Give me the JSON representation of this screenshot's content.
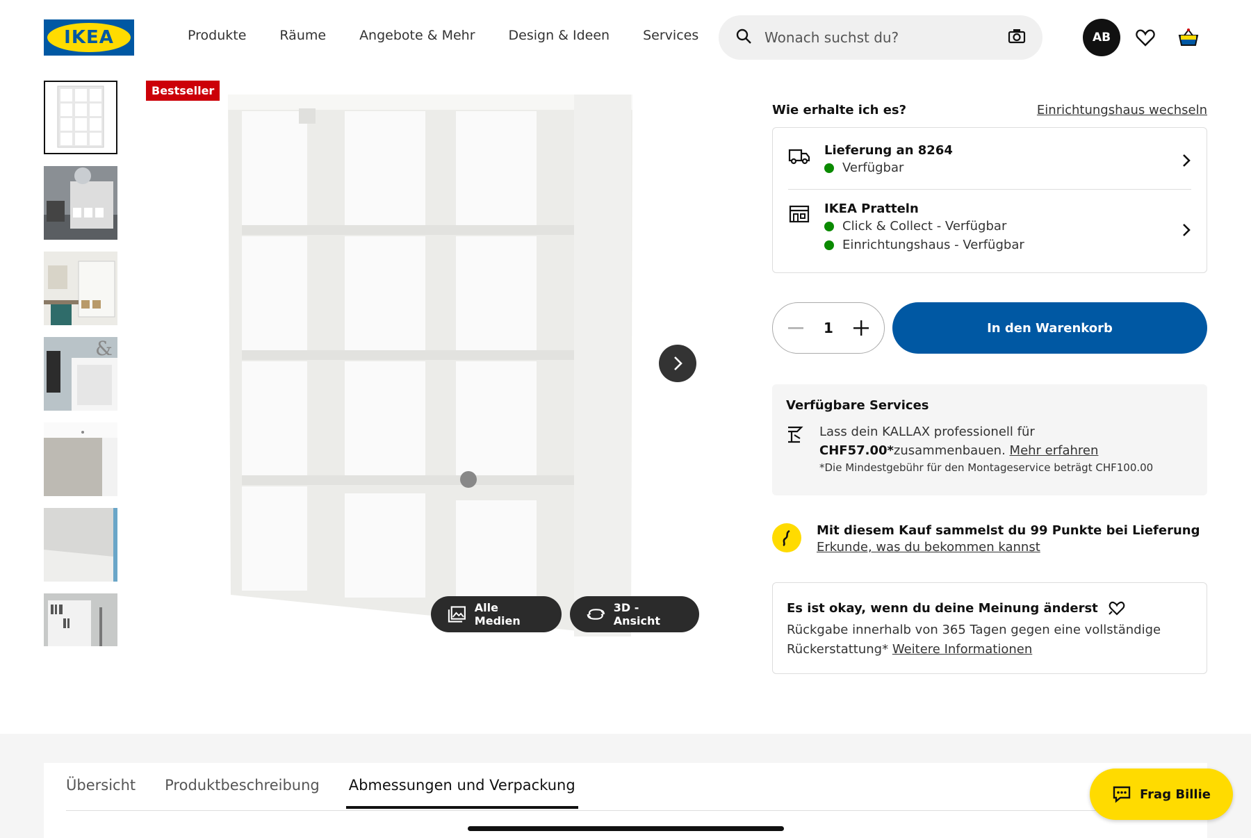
{
  "brand": {
    "logo_text": "IKEA",
    "primary": "#0058a3",
    "yellow": "#ffdb00"
  },
  "nav": {
    "items": [
      "Produkte",
      "Räume",
      "Angebote & Mehr",
      "Design & Ideen",
      "Services"
    ]
  },
  "search": {
    "placeholder": "Wonach suchst du?"
  },
  "user": {
    "initials": "AB"
  },
  "product": {
    "badge": "Bestseller"
  },
  "gallery": {
    "all_media": "Alle Medien",
    "view_3d": "3D -Ansicht"
  },
  "delivery": {
    "heading": "Wie erhalte ich es?",
    "change_store": "Einrichtungshaus wechseln",
    "ship_title": "Lieferung an 8264",
    "ship_status": "Verfügbar",
    "store_title": "IKEA Pratteln",
    "store_click": "Click & Collect - Verfügbar",
    "store_house": "Einrichtungshaus - Verfügbar",
    "available_color": "#0a8a00"
  },
  "purchase": {
    "quantity": "1",
    "add_to_cart": "In den Warenkorb"
  },
  "services": {
    "heading": "Verfügbare Services",
    "text_pre": "Lass dein KALLAX professionell für",
    "price": "CHF57.00*",
    "text_post": "zusammenbauen.",
    "more": "Mehr erfahren",
    "note": "*Die Mindestgebühr für den Montageservice beträgt CHF100.00"
  },
  "points": {
    "title": "Mit diesem Kauf sammelst du 99 Punkte bei Lieferung",
    "link": "Erkunde, was du bekommen kannst"
  },
  "returns": {
    "title": "Es ist okay, wenn du deine Meinung änderst",
    "text_line1": "Rückgabe innerhalb von 365 Tagen gegen eine vollständige",
    "text_line2": "Rückerstattung*",
    "link": "Weitere Informationen"
  },
  "tabs": [
    "Übersicht",
    "Produktbeschreibung",
    "Abmessungen und Verpackung"
  ],
  "chat": {
    "label": "Frag Billie"
  }
}
